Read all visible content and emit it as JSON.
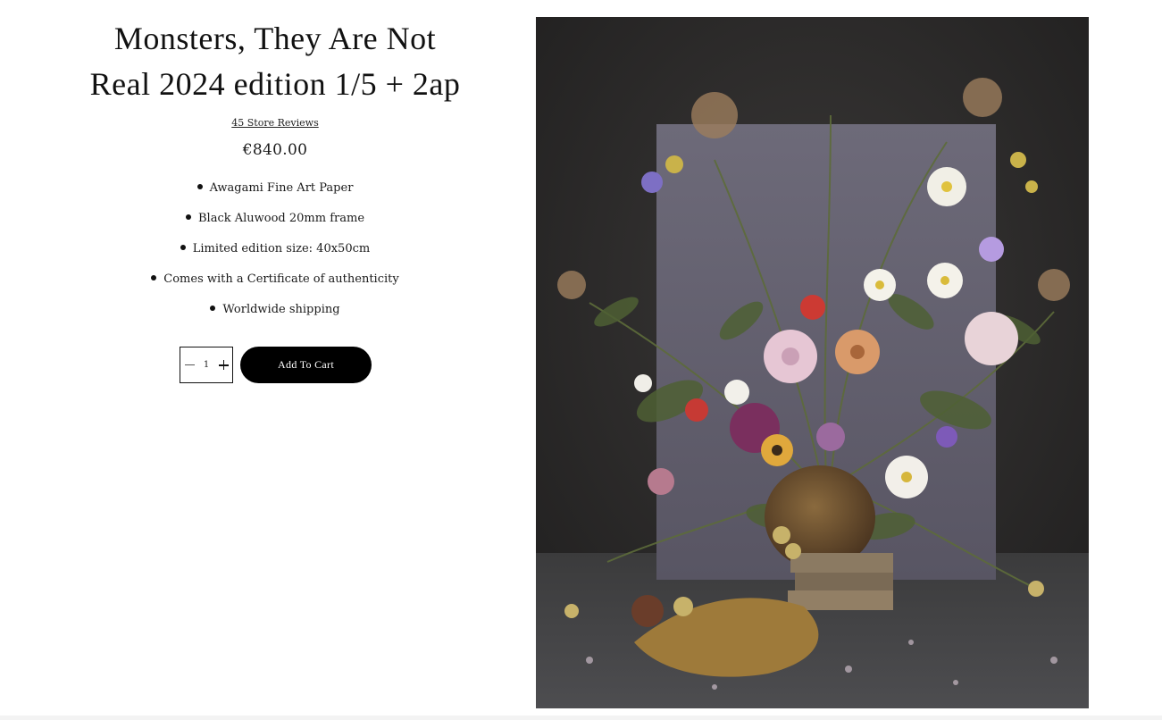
{
  "product": {
    "title_line1": "Monsters, They Are Not",
    "title_line2": "Real 2024 edition 1/5 + 2ap",
    "reviews_link": "45 Store Reviews",
    "price": "€840.00",
    "features": [
      "Awagami Fine Art Paper",
      "Black Aluwood 20mm frame",
      "Limited edition size: 40x50cm",
      "Comes with a Certificate of authenticity",
      "Worldwide shipping"
    ]
  },
  "purchase": {
    "quantity": "1",
    "decrease_icon": "minus-icon",
    "increase_icon": "plus-icon",
    "add_to_cart_label": "Add To Cart"
  },
  "image": {
    "subject": "flower-still-life-photograph"
  },
  "colors": {
    "button_bg": "#000000",
    "button_text": "#ffffff",
    "text": "#111111",
    "background": "#ffffff"
  }
}
